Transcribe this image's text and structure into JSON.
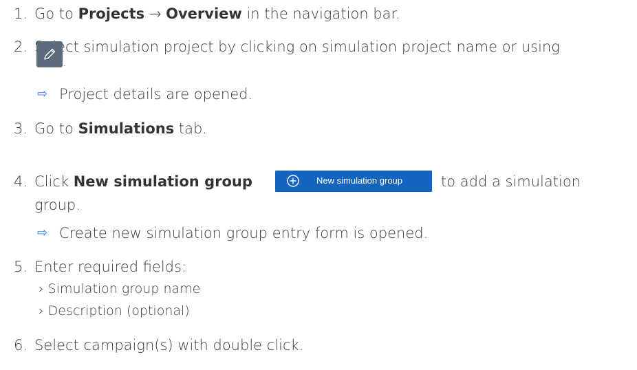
{
  "steps": [
    {
      "number": "1.",
      "pre": "Go to ",
      "bold1": "Projects",
      "arrow": " → ",
      "bold2": "Overview",
      "post": " in the navigation bar."
    },
    {
      "number": "2.",
      "text": "Select simulation project by clicking on simulation project name or using",
      "icon": "pencil-edit-icon",
      "trailing": ".",
      "result": "Project details are opened."
    },
    {
      "number": "3.",
      "pre": "Go to ",
      "bold": "Simulations",
      "post": " tab."
    },
    {
      "number": "4.",
      "pre": "Click ",
      "bold": "New simulation group",
      "post": " to add a simulation",
      "post2": "group.",
      "button_label": "New simulation group",
      "button_icon": "plus-circle-icon",
      "result": "Create new simulation group entry form is opened."
    },
    {
      "number": "5.",
      "text": "Enter required fields:",
      "subitems": [
        "› Simulation group name",
        "› Description (optional)"
      ]
    },
    {
      "number": "6.",
      "text": "Select campaign(s) with double click."
    }
  ],
  "result_arrow": "⇨",
  "colors": {
    "text": "#3a3a3a",
    "button_blue": "#1565c0",
    "edit_button": "#5c6b7a",
    "result_arrow": "#3a7bd5"
  }
}
